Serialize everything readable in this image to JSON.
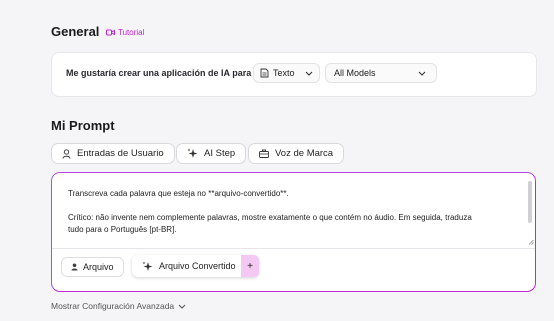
{
  "general": {
    "title": "General",
    "tutorial_label": "Tutorial",
    "sentence": "Me gustaría crear una aplicación de IA para",
    "type_select": {
      "value": "Texto",
      "icon": "document-icon"
    },
    "model_select": {
      "value": "All Models"
    }
  },
  "prompt_section": {
    "title": "Mi Prompt",
    "buttons": [
      {
        "label": "Entradas de Usuario",
        "icon": "user-icon"
      },
      {
        "label": "AI Step",
        "icon": "sparkle-icon"
      },
      {
        "label": "Voz de Marca",
        "icon": "briefcase-icon"
      }
    ],
    "prompt_line1": "Transcreva cada palavra que esteja no **arquivo-convertido**.",
    "prompt_line2": "Crítico: não invente nem complemente palavras, mostre exatamente o que contém no áudio. Em seguida, traduza",
    "prompt_line3": "tudo para o Português [pt-BR].",
    "chips": {
      "arquivo": "Arquivo",
      "convertido": "Arquivo Convertido",
      "plus": "+"
    }
  },
  "advanced_label": "Mostrar Configuración Avanzada",
  "colors": {
    "accent": "#c026d3",
    "accent_light": "#f3c8f2",
    "border_purple": "#8b5cf6"
  }
}
